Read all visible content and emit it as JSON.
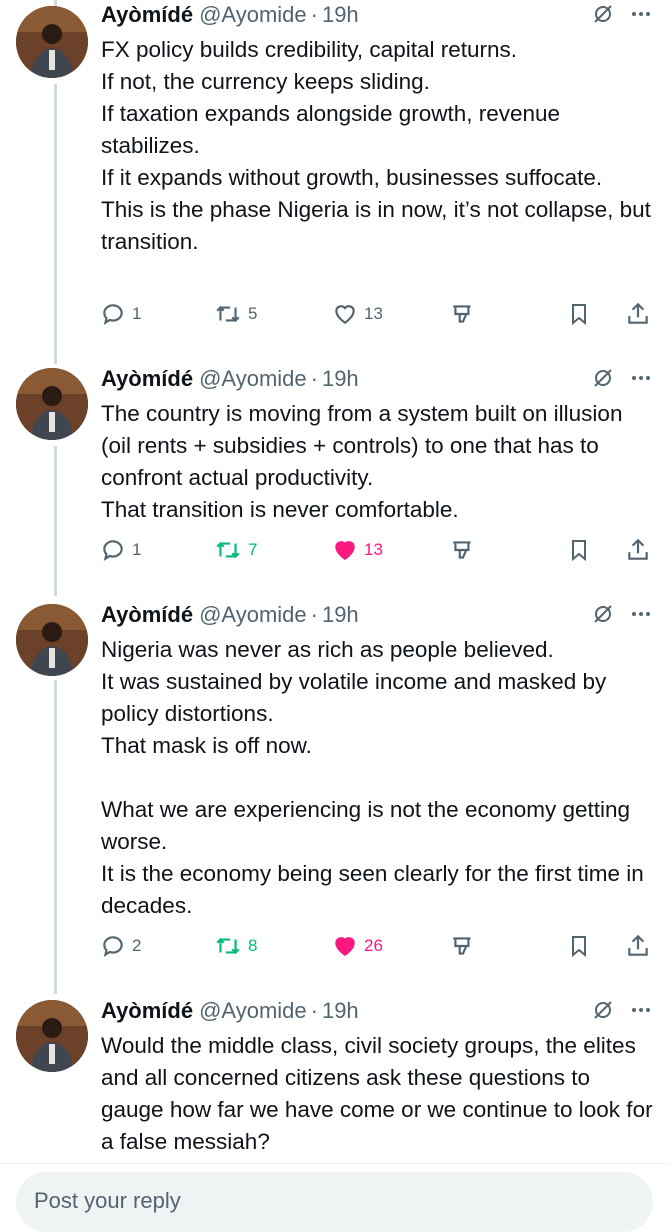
{
  "tweets": [
    {
      "name": "Ayòmídé",
      "handle": "@Ayomide",
      "dot": "·",
      "time": "19h",
      "text": "FX policy builds credibility, capital returns.\nIf not, the currency keeps sliding.\nIf taxation expands alongside growth, revenue stabilizes.\nIf it expands without growth, businesses suffocate.\nThis is the phase Nigeria is in now, it’s not collapse, but transition.",
      "replies": "1",
      "reposts": "5",
      "likes": "13",
      "liked": false
    },
    {
      "name": "Ayòmídé",
      "handle": "@Ayomide",
      "dot": "·",
      "time": "19h",
      "text": "The country is moving from a system built on illusion (oil rents + subsidies + controls) to one that has to confront actual productivity.\nThat transition is never comfortable.",
      "replies": "1",
      "reposts": "7",
      "likes": "13",
      "liked": true
    },
    {
      "name": "Ayòmídé",
      "handle": "@Ayomide",
      "dot": "·",
      "time": "19h",
      "text": "Nigeria was never as rich as people believed.\nIt was sustained by volatile income and masked by policy distortions.\nThat mask is off now.\n\nWhat we are experiencing is not the economy getting worse.\nIt is the economy being seen clearly for the first time in decades.",
      "replies": "2",
      "reposts": "8",
      "likes": "26",
      "liked": true
    },
    {
      "name": "Ayòmídé",
      "handle": "@Ayomide",
      "dot": "·",
      "time": "19h",
      "text": "Would the middle class, civil society groups, the elites and all concerned citizens ask these questions to gauge how far we have come or we continue to look for a false messiah?"
    }
  ],
  "reply_placeholder": "Post your reply",
  "icons": {
    "reply": "reply-icon",
    "repost": "repost-icon",
    "like": "like-icon",
    "grok": "grok-icon",
    "more": "more-icon",
    "stats": "stats-icon",
    "bookmark": "bookmark-icon",
    "share": "share-icon"
  },
  "colors": {
    "text": "#0f1419",
    "secondary": "#536471",
    "repost_active": "#00ba7c",
    "like_active": "#f91880",
    "thread_line": "#cfd9de"
  }
}
